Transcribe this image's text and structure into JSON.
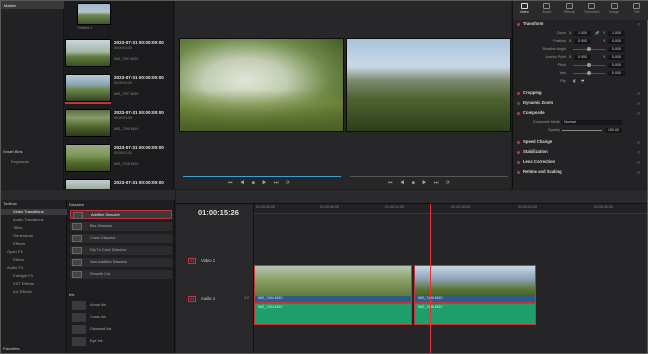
{
  "media_pool": {
    "master_label": "Master",
    "smart_bins_label": "Smart Bins",
    "keywords_label": "Keywords",
    "first_clip_name": "Timeline 1",
    "clips": [
      {
        "date": "2023-07-31",
        "tc": "00:00:00:00",
        "sub": "00:00:01:00",
        "name": "IMG_7297.MOV"
      },
      {
        "date": "2023-07-31",
        "tc": "00:00:00:00",
        "sub": "00:00:01:00",
        "name": "IMG_7297.MOV"
      },
      {
        "date": "2023-07-31",
        "tc": "00:00:00:00",
        "sub": "00:00:01:00",
        "name": "IMG_7190.MOV"
      },
      {
        "date": "2023-07-31",
        "tc": "00:00:00:00",
        "sub": "00:00:01:00",
        "name": "IMG_7218.MOV"
      },
      {
        "date": "2023-07-31",
        "tc": "00:00:00:00",
        "sub": "00:00:01:00",
        "name": "IMG_7218.MOV"
      }
    ]
  },
  "inspector": {
    "tabs": [
      "Video",
      "Audio",
      "Effects",
      "Transition",
      "Image",
      "File"
    ],
    "active_tab": "Video",
    "transform_label": "Transform",
    "rows": [
      {
        "label": "Zoom",
        "x": "1.000",
        "y": "1.000"
      },
      {
        "label": "Position",
        "x": "0.000",
        "y": "0.000"
      },
      {
        "label": "Rotation Angle",
        "x": "0.000"
      },
      {
        "label": "Anchor Point",
        "x": "0.000",
        "y": "0.000"
      },
      {
        "label": "Pitch",
        "x": "0.000"
      },
      {
        "label": "Yaw",
        "x": "0.000"
      },
      {
        "label": "Flip",
        "x": ""
      }
    ],
    "cropping": "Cropping",
    "dynamic_zoom": "Dynamic Zoom",
    "composite": "Composite",
    "composite_mode_label": "Composite Mode",
    "composite_mode_value": "Normal",
    "opacity_label": "Opacity",
    "opacity_value": "100.00",
    "speed_change": "Speed Change",
    "stabilization": "Stabilization",
    "lens_correction": "Lens Correction",
    "retime_scaling": "Retime and Scaling"
  },
  "effects": {
    "toolbox": "Toolbox",
    "side_items": [
      "Video Transitions",
      "Audio Transitions",
      "Titles",
      "Generators",
      "Effects",
      "Open FX",
      "Filters",
      "Audio FX",
      "Fairlight FX",
      "VST Effects",
      "AU Effects"
    ],
    "favorites": "Favorites",
    "dissolve_group": "Dissolve",
    "dissolves": [
      "Additive Dissolve",
      "Blur Dissolve",
      "Cross Dissolve",
      "Dip To Color Dissolve",
      "Non-Additive Dissolve",
      "Smooth Cut"
    ],
    "iris_group": "Iris",
    "iris": [
      "Arrow Iris",
      "Cross Iris",
      "Diamond Iris",
      "Eye Iris"
    ]
  },
  "timeline": {
    "timecode": "01:00:15:26",
    "ruler": [
      "01:00:00:00",
      "01:00:06:00",
      "01:00:12:00",
      "01:00:18:00",
      "01:00:24:00",
      "01:00:30:00",
      "01:00:36:00"
    ],
    "video_track_id": "V1",
    "video_track_name": "Video 1",
    "audio_track_id": "A1",
    "audio_track_name": "Audio 1",
    "audio_level": "2.0",
    "clip_a": "IMG_7434.MOV",
    "clip_b": "IMG_7436.MOV"
  }
}
